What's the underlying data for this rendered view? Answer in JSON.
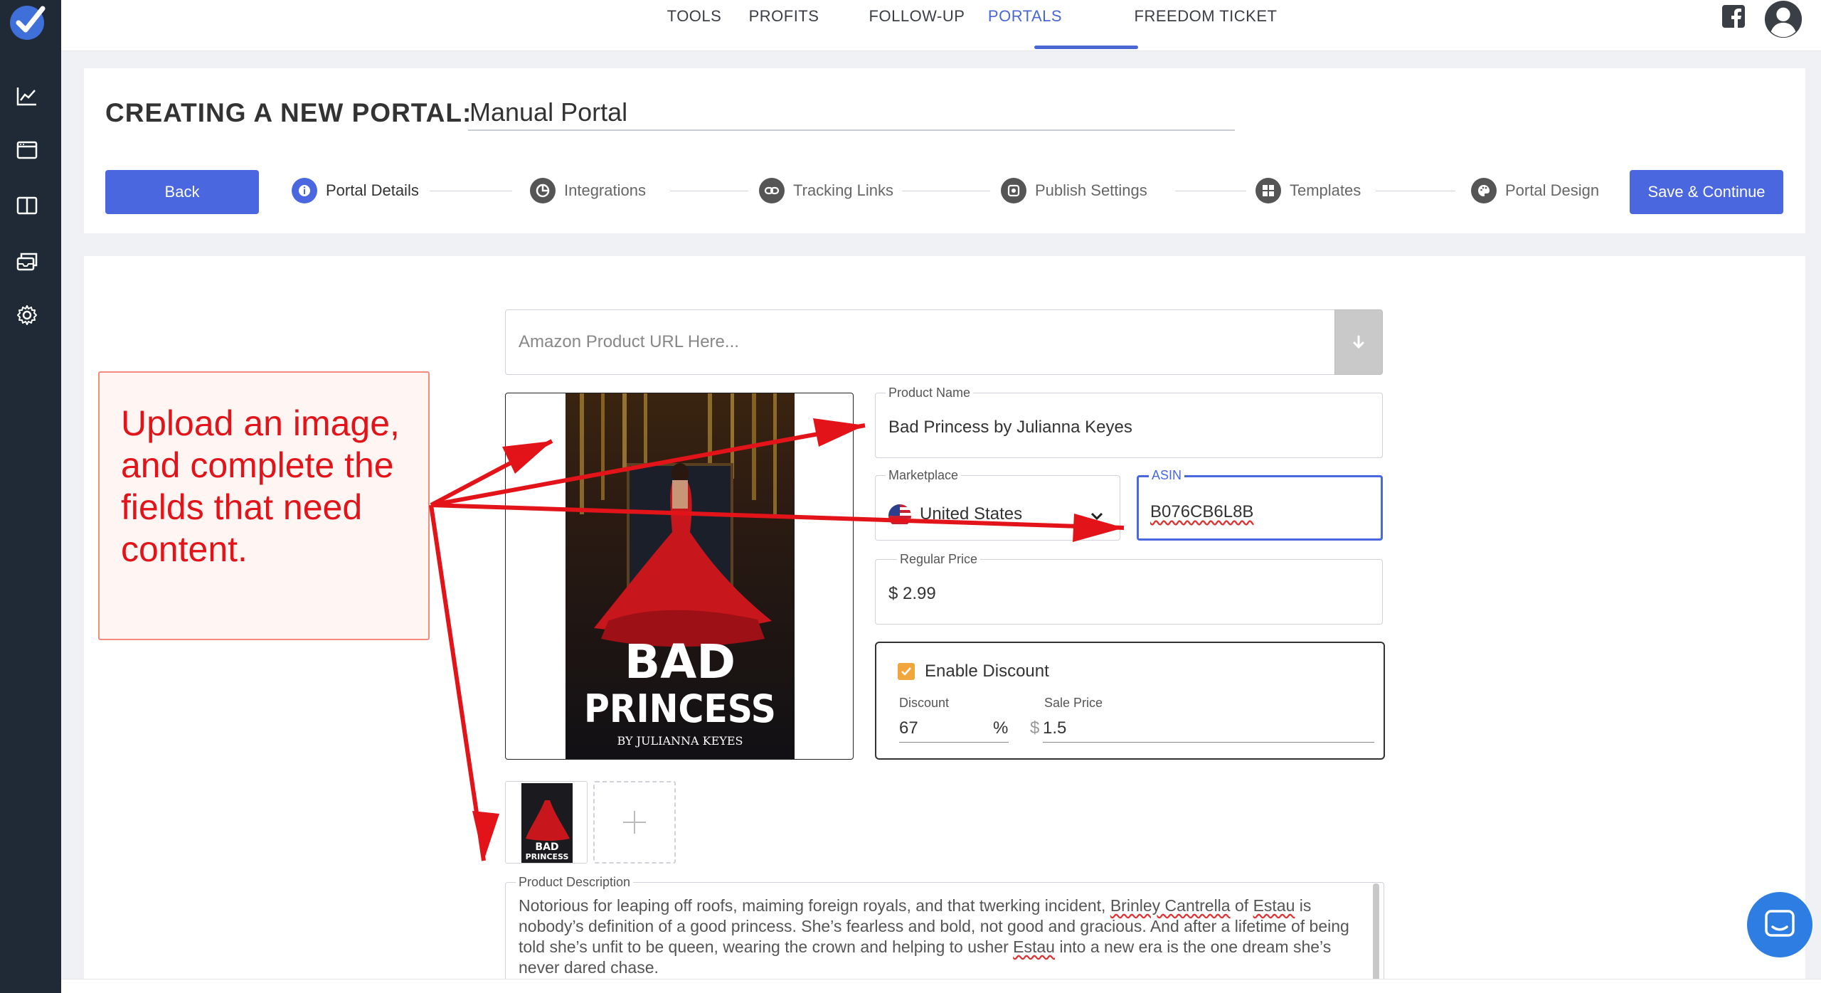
{
  "nav": {
    "tabs": [
      "TOOLS",
      "PROFITS",
      "FOLLOW-UP",
      "PORTALS",
      "FREEDOM TICKET"
    ],
    "active_tab": "PORTALS"
  },
  "sidebar": {
    "icons": [
      "chart-line-icon",
      "browser-window-icon",
      "columns-icon",
      "inbox-stack-icon",
      "gear-icon"
    ]
  },
  "header": {
    "title": "CREATING A NEW PORTAL:",
    "portal_name": "Manual Portal",
    "back_label": "Back",
    "save_label": "Save & Continue",
    "steps": [
      "Portal Details",
      "Integrations",
      "Tracking Links",
      "Publish Settings",
      "Templates",
      "Portal Design"
    ],
    "active_step": "Portal Details"
  },
  "form": {
    "url_placeholder": "Amazon Product URL Here...",
    "product_name_label": "Product Name",
    "product_name": "Bad Princess by Julianna Keyes",
    "marketplace_label": "Marketplace",
    "marketplace": "United States",
    "asin_label": "ASIN",
    "asin": "B076CB6L8B",
    "regular_price_label": "Regular Price",
    "regular_price": "$ 2.99",
    "enable_discount_label": "Enable Discount",
    "enable_discount": true,
    "discount_label": "Discount",
    "discount": "67",
    "discount_unit": "%",
    "sale_price_label": "Sale Price",
    "sale_price_currency": "$",
    "sale_price": "1.5",
    "description_label": "Product Description",
    "description_parts": [
      "Notorious for leaping off roofs, maiming foreign royals, and that twerking incident, ",
      "Brinley Cantrella",
      " of ",
      "Estau",
      " is nobody’s definition of a good princess. She’s fearless and bold, not good and gracious. And after a lifetime of being told she’s unfit to be queen, wearing the crown and helping to usher ",
      "Estau",
      " into a new era is the one dream she’s never dared chase."
    ]
  },
  "book": {
    "title_line1": "BAD",
    "title_line2": "PRINCESS",
    "author": "BY JULIANNA KEYES"
  },
  "annotation": {
    "text": "Upload an image, and complete the fields that need content."
  },
  "colors": {
    "accent": "#4a67e0",
    "sidebar": "#1f2a36",
    "annotation_red": "#e2141a",
    "checkbox": "#f0a63a",
    "chat": "#2d7de2"
  }
}
